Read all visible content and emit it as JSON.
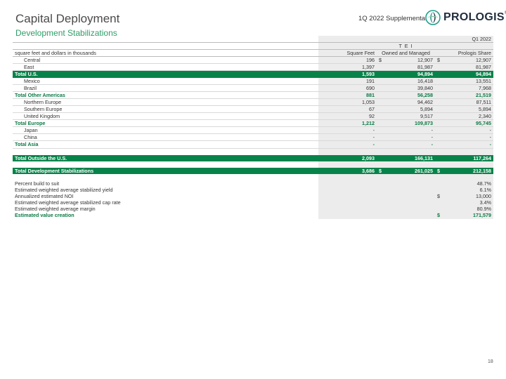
{
  "header": {
    "title": "Capital Deployment",
    "subtitle": "Development Stabilizations",
    "supplemental": "1Q 2022 Supplemental",
    "logo_text": "PROLOGIS",
    "logo_mark": "®"
  },
  "table": {
    "period": "Q1 2022",
    "group_label": "T E I",
    "units_label": "square feet and dollars in thousands",
    "columns": [
      "Square Feet",
      "Owned and Managed",
      "Prologis Share"
    ],
    "currency_symbol": "$",
    "rows": {
      "central": {
        "label": "Central",
        "sf": "196",
        "om": "12,907",
        "ps": "12,907"
      },
      "east": {
        "label": "East",
        "sf": "1,397",
        "om": "81,987",
        "ps": "81,987"
      },
      "total_us": {
        "label": "Total U.S.",
        "sf": "1,593",
        "om": "94,894",
        "ps": "94,894"
      },
      "mexico": {
        "label": "Mexico",
        "sf": "191",
        "om": "16,418",
        "ps": "13,551"
      },
      "brazil": {
        "label": "Brazil",
        "sf": "690",
        "om": "39,840",
        "ps": "7,968"
      },
      "total_other_americas": {
        "label": "Total Other Americas",
        "sf": "881",
        "om": "56,258",
        "ps": "21,519"
      },
      "northern_europe": {
        "label": "Northern Europe",
        "sf": "1,053",
        "om": "94,462",
        "ps": "87,511"
      },
      "southern_europe": {
        "label": "Southern Europe",
        "sf": "67",
        "om": "5,894",
        "ps": "5,894"
      },
      "united_kingdom": {
        "label": "United Kingdom",
        "sf": "92",
        "om": "9,517",
        "ps": "2,340"
      },
      "total_europe": {
        "label": "Total Europe",
        "sf": "1,212",
        "om": "109,873",
        "ps": "95,745"
      },
      "japan": {
        "label": "Japan",
        "sf": "-",
        "om": "-",
        "ps": "-"
      },
      "china": {
        "label": "China",
        "sf": "-",
        "om": "-",
        "ps": "-"
      },
      "total_asia": {
        "label": "Total Asia",
        "sf": "-",
        "om": "-",
        "ps": "-"
      },
      "total_outside_us": {
        "label": "Total Outside the U.S.",
        "sf": "2,093",
        "om": "166,131",
        "ps": "117,264"
      },
      "total_dev_stab": {
        "label": "Total Development Stabilizations",
        "sf": "3,686",
        "om": "261,025",
        "ps": "212,158"
      }
    },
    "metrics": {
      "build_to_suit": {
        "label": "Percent build to suit",
        "value": "48.7%"
      },
      "stabilized_yield": {
        "label": "Estimated weighted average stabilized yield",
        "value": "6.1%"
      },
      "annualized_noi": {
        "label": "Annualized estimated NOI",
        "value": "13,000"
      },
      "cap_rate": {
        "label": "Estimated weighted average stabilized cap rate",
        "value": "3.4%"
      },
      "margin": {
        "label": "Estimated weighted average margin",
        "value": "80.9%"
      },
      "value_creation": {
        "label": "Estimated value creation",
        "value": "171,579"
      }
    }
  },
  "footer": {
    "page_number": "18"
  },
  "colors": {
    "brand_green": "#07834a",
    "accent_green": "#2e9e68",
    "logo_teal": "#1a9b8a"
  }
}
